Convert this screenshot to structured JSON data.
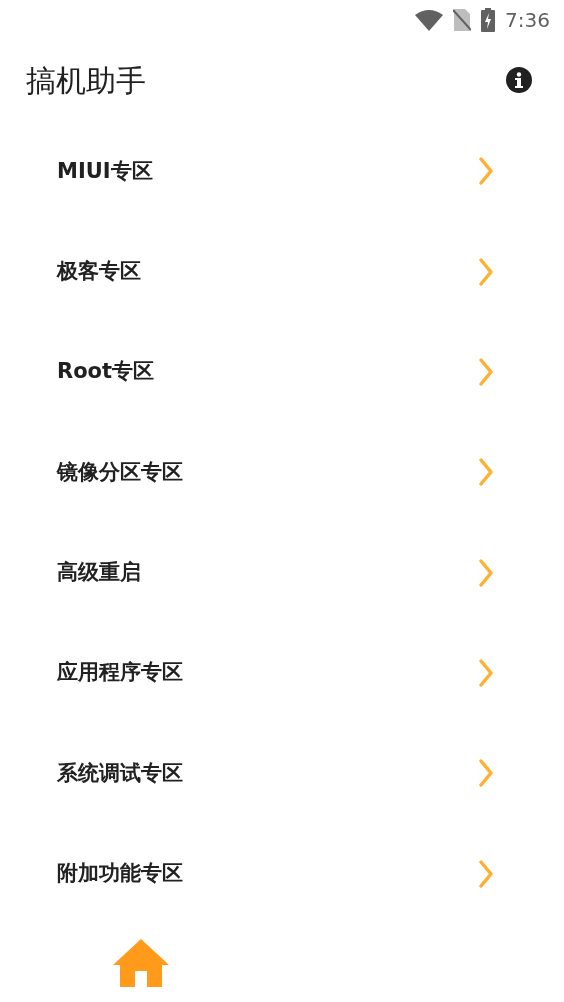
{
  "status_bar": {
    "time": "7:36"
  },
  "app_bar": {
    "title": "搞机助手"
  },
  "menu": [
    {
      "label": "MIUI专区"
    },
    {
      "label": "极客专区"
    },
    {
      "label": "Root专区"
    },
    {
      "label": "镜像分区专区"
    },
    {
      "label": "高级重启"
    },
    {
      "label": "应用程序专区"
    },
    {
      "label": "系统调试专区"
    },
    {
      "label": "附加功能专区"
    }
  ],
  "bottom_nav": [
    {
      "kind": "home",
      "selected": true
    }
  ]
}
